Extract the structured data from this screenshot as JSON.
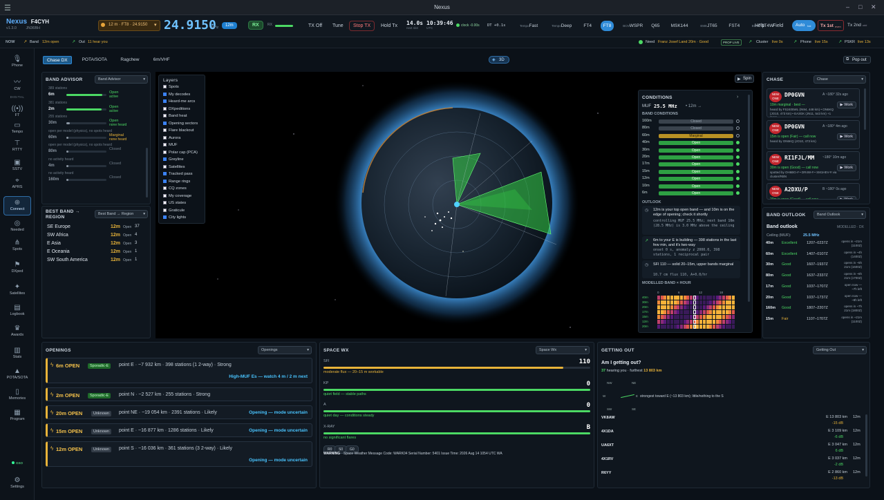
{
  "window": {
    "title": "Nexus"
  },
  "brand": {
    "name": "Nexus",
    "callsign": "F4CYH",
    "version": "v1.3.0",
    "grid": "JN36BH"
  },
  "top": {
    "band_select": "12 m · FT8 · 24.9150",
    "frequency": "24.9150",
    "freq_unit": "MHz",
    "band_badge": "12m",
    "rx_btn": "RX",
    "rx_label": "RX",
    "tx_label": "TX",
    "tx_off": "TX Off",
    "tune": "Tune",
    "stop_tx": "Stop TX",
    "hold_tx": "Hold Tx",
    "seconds": "14.0s",
    "seconds_sub": "next slot",
    "clock": "10:39:46",
    "clock_sub": "UTC",
    "clock_status": "clock -0.00s",
    "dt": "DT +0.1s",
    "modes": [
      {
        "prefix": "Tempo",
        "name": "Fast"
      },
      {
        "prefix": "Tempo",
        "name": "Deep"
      },
      {
        "prefix": "",
        "name": "FT4"
      },
      {
        "prefix": "",
        "name": "FT8",
        "active": true
      },
      {
        "prefix": "BCN",
        "name": "WSPR"
      },
      {
        "prefix": "",
        "name": "Q65"
      },
      {
        "prefix": "",
        "name": "MSK144"
      },
      {
        "prefix": "EME",
        "name": "JT65"
      },
      {
        "prefix": "",
        "name": "FST4"
      },
      {
        "prefix": "BCN",
        "name": "FST4W"
      }
    ],
    "help": "Help",
    "field": "Field",
    "auto": "Auto",
    "auto_sub": "hal",
    "tx1st": "Tx 1st",
    "tx1st_sub": "even",
    "tx2nd": "Tx 2nd",
    "tx2nd_sub": "odd"
  },
  "now": {
    "label": "NOW",
    "band": "Band",
    "band_val": "12m open",
    "out": "Out",
    "out_val": "11 hear you",
    "need": "Need",
    "need_val": "Franz Josef Land 20m · Good",
    "prop_live": "PROP LIVE",
    "cluster": "Cluster",
    "cluster_val": "live 0s",
    "phone": "Phone",
    "phone_val": "live 15s",
    "pskr": "PSKR",
    "pskr_val": "live 13s"
  },
  "sidebar": [
    {
      "label": "Phone",
      "icon": "mic-icon"
    },
    {
      "label": "CW",
      "icon": "key-icon"
    },
    {
      "label": "DIGITAL",
      "icon": ""
    },
    {
      "label": "FT",
      "icon": "wave-icon"
    },
    {
      "label": "Tempo",
      "icon": "chat-icon"
    },
    {
      "label": "RTTY",
      "icon": "teletype-icon"
    },
    {
      "label": "SSTV",
      "icon": "image-icon"
    },
    {
      "label": "APRS",
      "icon": "pin-icon"
    },
    {
      "label": "Connect",
      "icon": "globe-icon"
    },
    {
      "label": "Needed",
      "icon": "target-icon"
    },
    {
      "label": "Spots",
      "icon": "antenna-icon"
    },
    {
      "label": "DXped",
      "icon": "flag-icon"
    },
    {
      "label": "Satellites",
      "icon": "satellite-icon"
    },
    {
      "label": "Logbook",
      "icon": "book-icon"
    },
    {
      "label": "Awards",
      "icon": "trophy-icon"
    },
    {
      "label": "Stats",
      "icon": "chart-icon"
    },
    {
      "label": "POTA/SOTA",
      "icon": "tree-icon"
    },
    {
      "label": "Memories",
      "icon": "doc-icon"
    },
    {
      "label": "Program",
      "icon": "calendar-icon"
    },
    {
      "label": "GSO",
      "icon": ""
    },
    {
      "label": "Settings",
      "icon": "gear-icon"
    }
  ],
  "tabs": [
    "Chase DX",
    "POTA/SOTA",
    "Ragchew",
    "6m/VHF"
  ],
  "map": {
    "btn3d": "3D",
    "popout": "Pop out",
    "spin": "Spin"
  },
  "band_advisor": {
    "title": "BAND ADVISOR",
    "select": "Band Advisor",
    "rows": [
      {
        "meta": "389 stations",
        "band": "6m",
        "state": "Open",
        "sub": "active",
        "level": 0.9,
        "color": "green"
      },
      {
        "meta": "381 stations",
        "band": "2m",
        "state": "Open",
        "sub": "active",
        "level": 0.88,
        "color": "green"
      },
      {
        "meta": "255 stations",
        "band": "30m",
        "state": "Open",
        "sub": "none heard",
        "level": 0.08,
        "color": "grey"
      },
      {
        "meta": "open per model (physics), no spots heard",
        "band": "60m",
        "state": "Marginal",
        "sub": "none heard",
        "level": 0.0,
        "color": "grey"
      },
      {
        "meta": "open per model (physics), no spots heard",
        "band": "80m",
        "state": "Closed",
        "sub": "",
        "level": 0.0,
        "color": "grey"
      },
      {
        "meta": "no activity heard",
        "band": "4m",
        "state": "Closed",
        "sub": "",
        "level": 0.0,
        "color": "grey"
      },
      {
        "meta": "no activity heard",
        "band": "160m",
        "state": "Closed",
        "sub": "",
        "level": 0.0,
        "color": "grey"
      }
    ]
  },
  "best_band": {
    "title": "BEST BAND → REGION",
    "select": "Best Band → Region",
    "rows": [
      {
        "region": "SE Europe",
        "band": "12m",
        "state": "Open",
        "n": "37"
      },
      {
        "region": "SW Africa",
        "band": "12m",
        "state": "Open",
        "n": "4"
      },
      {
        "region": "E Asia",
        "band": "12m",
        "state": "Open",
        "n": "3"
      },
      {
        "region": "E Oceania",
        "band": "12m",
        "state": "Open",
        "n": "1"
      },
      {
        "region": "SW South America",
        "band": "12m",
        "state": "Open",
        "n": "1"
      }
    ]
  },
  "layers": {
    "title": "Layers",
    "items": [
      {
        "label": "Spots",
        "on": false
      },
      {
        "label": "My decodes",
        "on": true
      },
      {
        "label": "Heard-me arcs",
        "on": true
      },
      {
        "label": "DXpeditions",
        "on": false
      },
      {
        "label": "Band heat",
        "on": false
      },
      {
        "label": "Opening sectors",
        "on": true
      },
      {
        "label": "Flare blackout",
        "on": false
      },
      {
        "label": "Aurora",
        "on": false
      },
      {
        "label": "MUF",
        "on": false
      },
      {
        "label": "Polar cap (PCA)",
        "on": false
      },
      {
        "label": "Greyline",
        "on": true
      },
      {
        "label": "Satellites",
        "on": false
      },
      {
        "label": "Tracked pass",
        "on": true
      },
      {
        "label": "Range rings",
        "on": true
      },
      {
        "label": "CQ zones",
        "on": false
      },
      {
        "label": "My coverage",
        "on": false
      },
      {
        "label": "US states",
        "on": false
      },
      {
        "label": "Graticule",
        "on": false
      },
      {
        "label": "City lights",
        "on": true
      }
    ]
  },
  "conditions": {
    "title": "CONDITIONS",
    "muf_label": "MUF",
    "muf": "25.5 MHz",
    "muf_band": "• 12m →",
    "band_cond_title": "BAND CONDITIONS",
    "rows": [
      {
        "band": "160m",
        "state": "Closed"
      },
      {
        "band": "80m",
        "state": "Closed"
      },
      {
        "band": "60m",
        "state": "Marginal"
      },
      {
        "band": "40m",
        "state": "Open"
      },
      {
        "band": "30m",
        "state": "Open"
      },
      {
        "band": "20m",
        "state": "Open"
      },
      {
        "band": "17m",
        "state": "Open"
      },
      {
        "band": "15m",
        "state": "Open"
      },
      {
        "band": "12m",
        "state": "Open"
      },
      {
        "band": "10m",
        "state": "Open"
      },
      {
        "band": "6m",
        "state": "Open"
      }
    ],
    "outlook_title": "OUTLOOK",
    "outlook": [
      {
        "text": "12m is your top open band — and 10m is on the edge of opening; check it shortly",
        "mono": "controlling MUF 25.5 MHz; next band 10m (28.5 MHz) is 3.0 MHz above the ceiling"
      },
      {
        "text": "6m to your E is building — 398 stations in the last few min, and it's two-way",
        "mono": "onset 0 s, anomaly z 2000.0, 398 stations, 1 reciprocal pair"
      },
      {
        "text": "SFI 110 — solid 20–15m, upper bands marginal",
        "mono": "10.7 cm flux 110, A+0.0/hr"
      }
    ],
    "heat_title": "MODELLED BAND × HOUR",
    "heat_hours": [
      "0",
      "6",
      "12",
      "18"
    ],
    "heat_bands": [
      "40m",
      "30m",
      "20m",
      "17m",
      "15m",
      "12m",
      "20m"
    ]
  },
  "chase": {
    "title": "CHASE",
    "select": "Chase",
    "cards": [
      {
        "badge": "NEW ONE",
        "call": "DP0GVN",
        "meta": "A ~180° 32s ago",
        "status": "10m marginal · best —",
        "detail": "heard by FS2405WL (IN94, 448 km) • ON6KQ (JO10, 473 km) • EA3GK (JN11, 543 km) +1 more",
        "work": "Work"
      },
      {
        "badge": "NEW ONE",
        "call": "DP0GVN",
        "meta": "A ~180° 4m ago",
        "status": "15m is open (Fair) — call now",
        "detail": "heard by ON6KQ (JO10, 473 km)",
        "work": "Work"
      },
      {
        "badge": "NEW ONE",
        "call": "RI1FJL/MM",
        "meta": "~180° 10m ago",
        "status": "30m is open (Good) — call now",
        "detail": "spotted by OH6BG-# • DR4W-# • SM1HEV-# via cluster/RBN",
        "work": "Work"
      },
      {
        "badge": "NEW ONE",
        "call": "A2DXU/P",
        "meta": "B ~180° 0s ago",
        "status": "20m is open (Good) — call now",
        "detail": "spotted by TR6SF-# • TM5SO-# • ...",
        "work": "Work"
      }
    ]
  },
  "band_outlook": {
    "title": "BAND OUTLOOK",
    "select": "Band Outlook",
    "heading": "Band outlook",
    "modelled": "MODELLED · DX",
    "ceiling_label": "Ceiling (MUF):",
    "ceiling": "25.5 MHz",
    "rows": [
      {
        "band": "40m",
        "q": "Excellent",
        "win": "1207–0237Z",
        "note": "opens in ~21m",
        "note2": "(1100Z)"
      },
      {
        "band": "60m",
        "q": "Excellent",
        "win": "1407–0107Z",
        "note": "opens in ~4h",
        "note2": "(1400Z)"
      },
      {
        "band": "30m",
        "q": "Good",
        "win": "1607–1937Z",
        "note": "opens in ~5h",
        "note2": "21m (1600Z)"
      },
      {
        "band": "80m",
        "q": "Good",
        "win": "1637–2337Z",
        "note": "opens in ~6h",
        "note2": "21m (1700Z)"
      },
      {
        "band": "17m",
        "q": "Good",
        "win": "1037–1707Z",
        "note": "open now —",
        "note2": "~7h left"
      },
      {
        "band": "20m",
        "q": "Good",
        "win": "1037–1737Z",
        "note": "open now —",
        "note2": "~8h left"
      },
      {
        "band": "160m",
        "q": "Good",
        "win": "1807–2207Z",
        "note": "opens in ~7h",
        "note2": "21m (1800Z)"
      },
      {
        "band": "15m",
        "q": "Fair",
        "win": "1107–1707Z",
        "note": "opens in ~21m",
        "note2": "(1100Z)"
      }
    ]
  },
  "openings": {
    "title": "OPENINGS",
    "select": "Openings",
    "cards": [
      {
        "band": "6m OPEN",
        "tag": "Sporadic-E",
        "tagtype": "sporadic",
        "desc": "point E · ~7 932 km · 398 stations (1 2-way) · Strong",
        "extra": "High-MUF Es — watch 4 m / 2 m next"
      },
      {
        "band": "2m OPEN",
        "tag": "Sporadic-E",
        "tagtype": "sporadic",
        "desc": "point N · ~2 527 km · 255 stations · Strong",
        "extra": ""
      },
      {
        "band": "20m OPEN",
        "tag": "Unknown",
        "tagtype": "unknown",
        "desc": "point NE · ~19 054 km · 2391 stations · Likely",
        "extra": "Opening — mode uncertain"
      },
      {
        "band": "15m OPEN",
        "tag": "Unknown",
        "tagtype": "unknown",
        "desc": "point E · ~16 877 km · 1286 stations · Likely",
        "extra": "Opening — mode uncertain"
      },
      {
        "band": "12m OPEN",
        "tag": "Unknown",
        "tagtype": "unknown",
        "desc": "point S · ~16 036 km · 361 stations (3 2-way) · Likely",
        "extra": "Opening — mode uncertain"
      }
    ]
  },
  "space_wx": {
    "title": "SPACE WX",
    "select": "Space Wx",
    "rows": [
      {
        "label": "SFI",
        "value": "110",
        "note": "moderate flux — 20–15 m workable",
        "level": 0.9
      },
      {
        "label": "KP",
        "value": "0",
        "note": "quiet field — stable paths",
        "level": 1.0
      },
      {
        "label": "A",
        "value": "0",
        "note": "quiet day — conditions steady",
        "level": 1.0
      },
      {
        "label": "X-RAY",
        "value": "B",
        "note": "no significant flares",
        "level": 1.0
      }
    ],
    "chips": [
      "R0",
      "S0",
      "G0"
    ],
    "warning_label": "WARNING",
    "warning": "Space Weather Message Code: WARK04 Serial Number: 5401 Issue Time: 2026 Aug 14 1054 UTC WA"
  },
  "getting_out": {
    "title": "GETTING OUT",
    "select": "Getting Out",
    "heading": "Am I getting out?",
    "summary_n": "37",
    "summary_a": "hearing you · furthest",
    "summary_km": "13 803 km",
    "compass_note": "strongest toward E (~13 803 km); little/nothing to the S",
    "compass": [
      "NW",
      "NE",
      "W",
      "E",
      "SW",
      "SE"
    ],
    "rows": [
      {
        "call": "VK8AW",
        "dist": "E 13 803 km",
        "db": "-15 dB",
        "band": "12m"
      },
      {
        "call": "4X1DA",
        "dist": "E 3 109 km",
        "db": "-6 dB",
        "band": "12m"
      },
      {
        "call": "UA6XT",
        "dist": "E 3 047 km",
        "db": "6 dB",
        "band": "12m"
      },
      {
        "call": "4X1RV",
        "dist": "E 3 037 km",
        "db": "-2 dB",
        "band": "12m"
      },
      {
        "call": "R6YY",
        "dist": "E 2 860 km",
        "db": "-13 dB",
        "band": "12m"
      }
    ]
  },
  "colors": {
    "accent": "#2f8bd8",
    "open": "#2ea043",
    "marginal": "#b89124",
    "closed": "#3a434d"
  }
}
